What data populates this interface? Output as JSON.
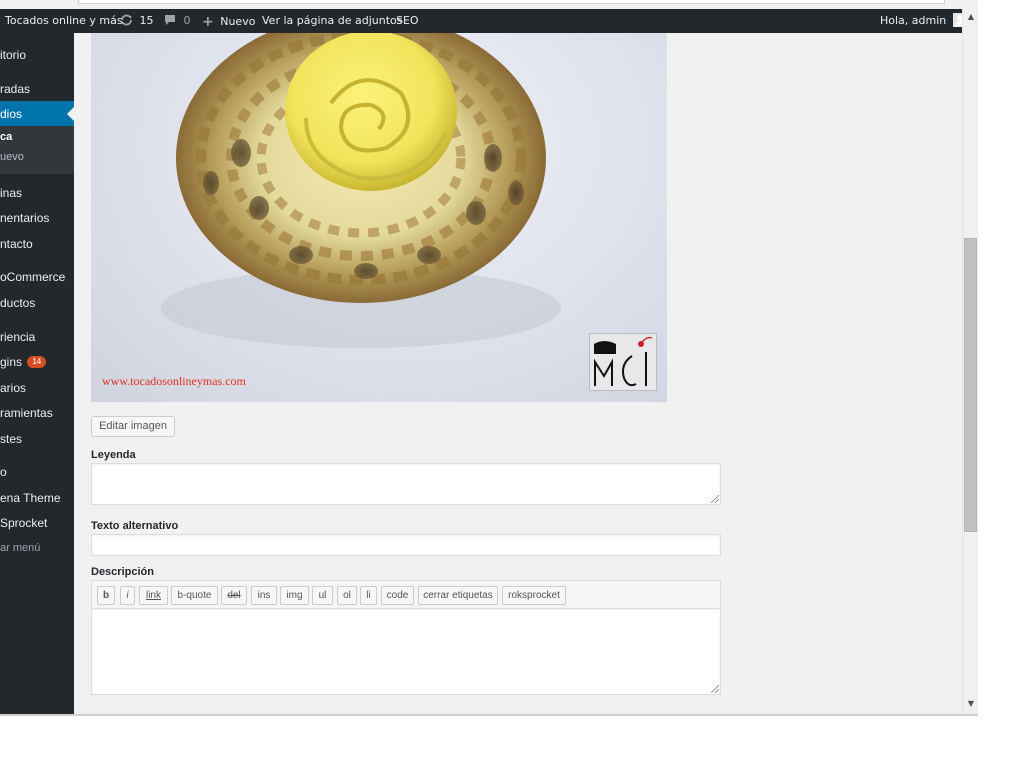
{
  "admin_bar": {
    "site_name": "Tocados online y más",
    "updates_icon": "refresh-icon",
    "updates_count": "15",
    "comments_icon": "comment-bubble-icon",
    "comments_count": "0",
    "new_icon": "plus-icon",
    "new_label": "Nuevo",
    "view_attachment": "Ver la página de adjuntos",
    "seo": "SEO",
    "greeting": "Hola, admin",
    "color": "#23282d"
  },
  "sidebar": {
    "items": [
      {
        "label": "itorio"
      },
      {
        "label": "radas"
      },
      {
        "label": "dios"
      },
      {
        "label": "inas"
      },
      {
        "label": "nentarios"
      },
      {
        "label": "ntacto"
      },
      {
        "label": "oCommerce"
      },
      {
        "label": "ductos"
      },
      {
        "label": "riencia"
      },
      {
        "label": "gins",
        "badge": "14"
      },
      {
        "label": "arios"
      },
      {
        "label": "ramientas"
      },
      {
        "label": "stes"
      },
      {
        "label": "o"
      },
      {
        "label": "ena Theme"
      },
      {
        "label": "Sprocket"
      },
      {
        "label": "ar menú"
      }
    ],
    "submenu": [
      {
        "label": "ca"
      },
      {
        "label": "uevo"
      }
    ],
    "accent_color": "#0073aa"
  },
  "media": {
    "watermark": "www.tocadosonlineymas.com",
    "edit_image_button": "Editar imagen",
    "caption_label": "Leyenda",
    "caption_value": "",
    "alt_label": "Texto alternativo",
    "alt_value": "",
    "description_label": "Descripción",
    "description_value": ""
  },
  "quicktags": [
    "b",
    "i",
    "link",
    "b-quote",
    "del",
    "ins",
    "img",
    "ul",
    "ol",
    "li",
    "code",
    "cerrar etiquetas",
    "roksprocket"
  ]
}
